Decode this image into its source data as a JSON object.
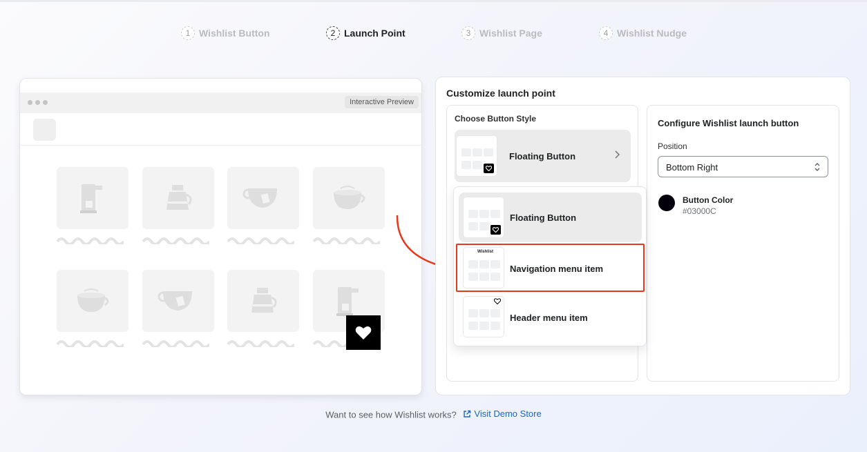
{
  "steps": [
    {
      "num": "1",
      "label": "Wishlist Button"
    },
    {
      "num": "2",
      "label": "Launch Point"
    },
    {
      "num": "3",
      "label": "Wishlist Page"
    },
    {
      "num": "4",
      "label": "Wishlist Nudge"
    }
  ],
  "preview": {
    "badge": "Interactive Preview"
  },
  "customize": {
    "title": "Customize launch point",
    "choose_label": "Choose Button Style",
    "selected_style": "Floating Button",
    "options": [
      {
        "label": "Floating Button"
      },
      {
        "label": "Navigation menu item",
        "thumb_text": "Wishlist"
      },
      {
        "label": "Header menu item"
      }
    ]
  },
  "config": {
    "title": "Configure Wishlist launch button",
    "position_label": "Position",
    "position_value": "Bottom Right",
    "color_label": "Button Color",
    "color_value": "#03000C"
  },
  "footer": {
    "question": "Want to see how Wishlist works?",
    "link": "Visit Demo Store"
  },
  "colors": {
    "accent_red": "#e5391c",
    "link_blue": "#1d64c8",
    "button_color": "#03000C"
  }
}
